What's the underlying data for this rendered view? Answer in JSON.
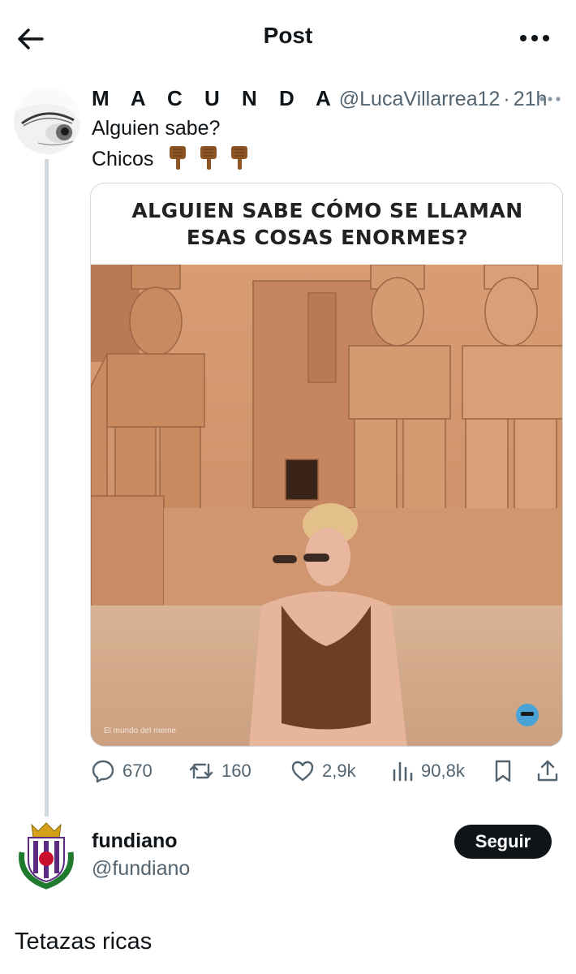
{
  "header": {
    "title": "Post"
  },
  "post": {
    "author": {
      "display_name": "M A C U N D A",
      "handle": "@LucaVillarrea12",
      "separator": "·",
      "time": "21h"
    },
    "text_lines": [
      "Alguien sabe?",
      "Chicos"
    ],
    "emoji": [
      "👇🏾",
      "👇🏾",
      "👇🏾"
    ],
    "media": {
      "caption_lines": [
        "ALGUIEN SABE CÓMO SE LLAMAN",
        "ESAS COSAS ENORMES?"
      ],
      "watermark": "El mundo del meme"
    },
    "actions": {
      "replies": "670",
      "reposts": "160",
      "likes": "2,9k",
      "views": "90,8k"
    }
  },
  "reply": {
    "author": {
      "display_name": "fundiano",
      "handle": "@fundiano"
    },
    "follow_label": "Seguir",
    "text": "Tetazas ricas"
  },
  "colors": {
    "text": "#0f1419",
    "secondary": "#536471",
    "border": "#cfd9de",
    "sandstone": "#c98f68"
  }
}
